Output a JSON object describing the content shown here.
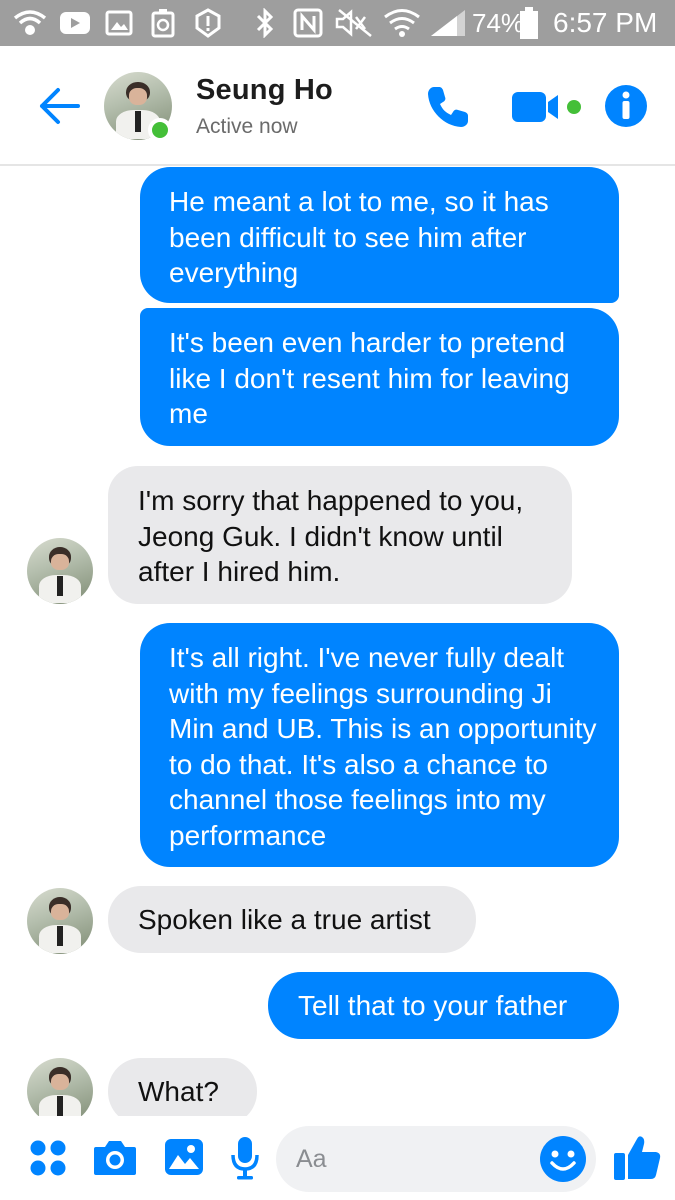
{
  "status_bar": {
    "battery_percent": "74%",
    "time": "6:57 PM",
    "icons": [
      "wifi-calling-icon",
      "youtube-icon",
      "image-icon",
      "recycle-icon",
      "alert-icon",
      "bluetooth-icon",
      "nfc-icon",
      "mute-icon",
      "wifi-icon",
      "signal-icon",
      "battery-icon"
    ]
  },
  "header": {
    "contact_name": "Seung Ho",
    "status": "Active now",
    "icons": {
      "back": "back-arrow-icon",
      "call": "phone-icon",
      "video": "video-camera-icon",
      "info": "info-icon"
    }
  },
  "conversation": {
    "messages": [
      {
        "direction": "outgoing",
        "text": "He meant a lot to me, so it has been difficult to see him after everything"
      },
      {
        "direction": "outgoing",
        "text": "It's been even harder to pretend like I don't resent him for leaving me"
      },
      {
        "direction": "incoming",
        "text": "I'm sorry that happened to you, Jeong Guk. I didn't know until after I hired him."
      },
      {
        "direction": "outgoing",
        "text": "It's all right. I've never fully dealt with my feelings surrounding Ji Min and UB. This is an opportunity to do that. It's also a chance to channel those feelings into my performance"
      },
      {
        "direction": "incoming",
        "text": "Spoken like a true artist"
      },
      {
        "direction": "outgoing",
        "text": "Tell that to your father"
      },
      {
        "direction": "incoming",
        "text": "What?"
      }
    ]
  },
  "composer": {
    "placeholder": "Aa",
    "value": "",
    "icons": [
      "apps-icon",
      "camera-icon",
      "gallery-icon",
      "microphone-icon",
      "emoji-icon",
      "thumbs-up-icon"
    ]
  },
  "colors": {
    "accent": "#0084ff",
    "outgoing_bubble": "#0084ff",
    "incoming_bubble": "#e9e9eb",
    "online": "#44bf38",
    "status_bar": "#9e9e9e"
  }
}
